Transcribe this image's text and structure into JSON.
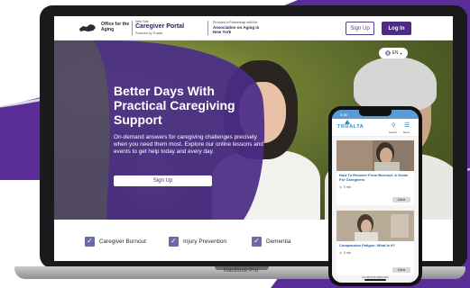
{
  "colors": {
    "brand_purple": "#4a2c86",
    "background_swoosh": "#5a2e96",
    "accent_blue": "#1f8fd0",
    "checkbox": "#6b6aa8"
  },
  "header": {
    "logo_icon": "new-york-state-map-icon",
    "office_name": "Office for the Aging",
    "portal_small": "New York",
    "portal_title": "Caregiver Portal",
    "portal_powered": "Powered by Trualta",
    "assoc_small": "Provided in Partnership with the",
    "assoc_title": "Association on Aging in New York",
    "signup_label": "Sign Up",
    "login_label": "Log In"
  },
  "hero": {
    "language_icon": "globe-icon",
    "language": "EN",
    "title": "Better Days With Practical Caregiving Support",
    "body": "On-demand answers for caregiving challenges precisely when you need them most. Explore our online lessons and events to get help today and every day.",
    "button_label": "Sign Up"
  },
  "topics": [
    {
      "label": "Caregiver Burnout",
      "checked": true
    },
    {
      "label": "Injury Prevention",
      "checked": true
    },
    {
      "label": "Dementia",
      "checked": true
    }
  ],
  "laptop": {
    "label": "MacBook Pro"
  },
  "phone": {
    "status_time": "5:38",
    "brand": "TRUALTA",
    "search_label": "Search",
    "menu_label": "Menu",
    "url": "ca.demo.trualta.com",
    "cards": [
      {
        "title": "How To Recover From Burnout: A Guide For Caregivers",
        "minutes": "5 min",
        "button": "Article"
      },
      {
        "title": "Compassion Fatigue: What Is It?",
        "minutes": "5 min",
        "button": "Article"
      }
    ]
  }
}
